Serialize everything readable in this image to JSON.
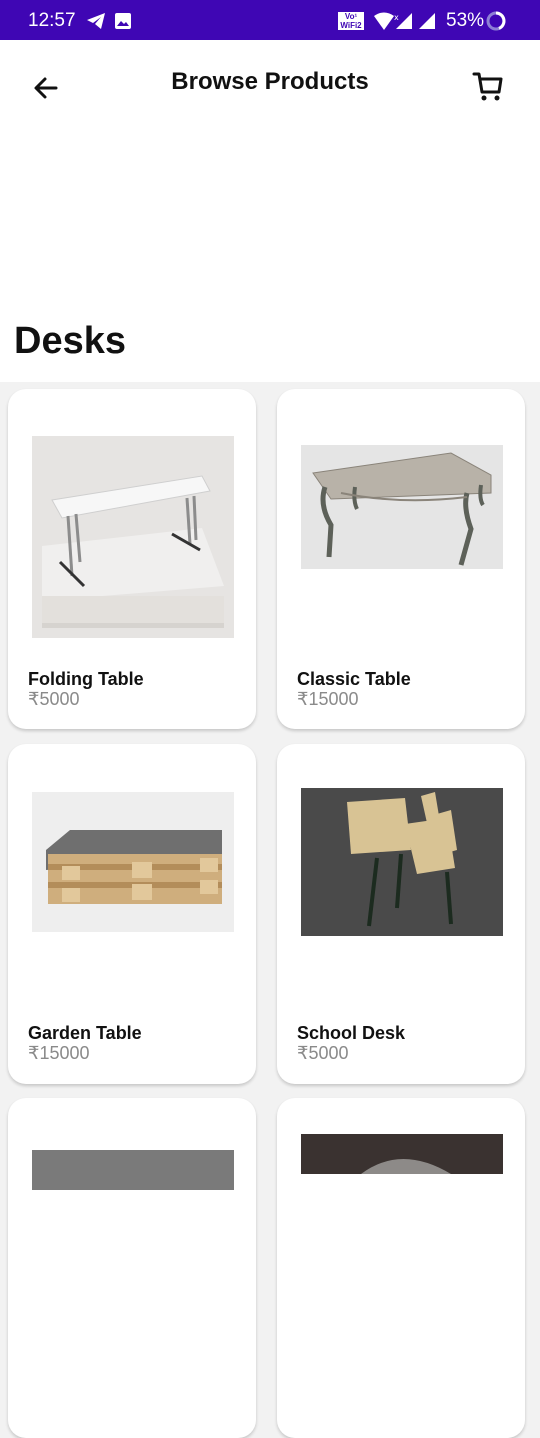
{
  "status_bar": {
    "time": "12:57",
    "battery": "53%",
    "wifi_label": "Vo¹ WiFi2"
  },
  "header": {
    "title": "Browse Products"
  },
  "section": {
    "title": "Desks"
  },
  "products": [
    {
      "name": "Folding Table",
      "price": "₹5000"
    },
    {
      "name": "Classic Table",
      "price": "₹15000"
    },
    {
      "name": "Garden Table",
      "price": "₹15000"
    },
    {
      "name": "School Desk",
      "price": "₹5000"
    },
    {
      "name": "",
      "price": ""
    },
    {
      "name": "",
      "price": ""
    }
  ],
  "colors": {
    "status_bar": "#3f06b4",
    "background": "#f2f2f2",
    "card": "#ffffff"
  }
}
